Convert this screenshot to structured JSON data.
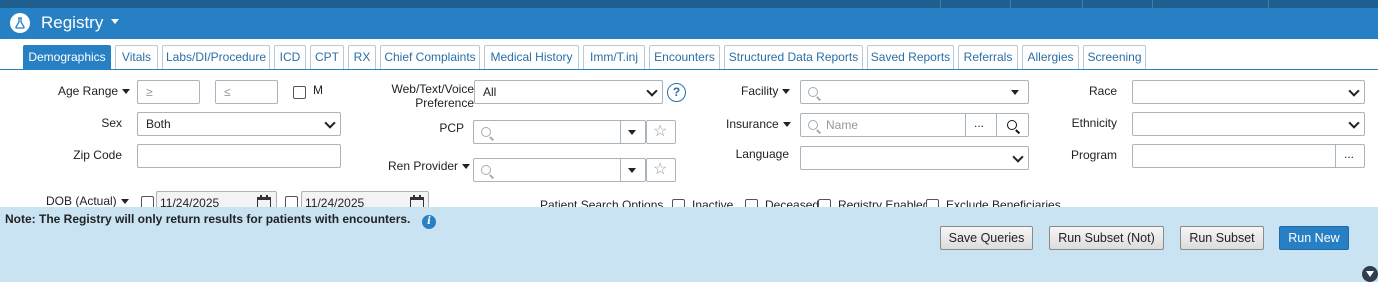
{
  "app": {
    "title": "Registry"
  },
  "tabs": [
    "Demographics",
    "Vitals",
    "Labs/DI/Procedure",
    "ICD",
    "CPT",
    "RX",
    "Chief Complaints",
    "Medical History",
    "Imm/T.inj",
    "Encounters",
    "Structured Data Reports",
    "Saved Reports",
    "Referrals",
    "Allergies",
    "Screening"
  ],
  "active_tab": "Demographics",
  "form": {
    "age_range": {
      "label": "Age Range",
      "min_placeholder": "≥",
      "max_placeholder": "≤",
      "m_label": "M"
    },
    "sex": {
      "label": "Sex",
      "value": "Both"
    },
    "zip": {
      "label": "Zip Code",
      "value": ""
    },
    "dob": {
      "label": "DOB (Actual)",
      "from": "11/24/2025",
      "to": "11/24/2025"
    },
    "preference": {
      "label": "Web/Text/Voice Preference",
      "value": "All"
    },
    "pcp": {
      "label": "PCP",
      "value": ""
    },
    "ren_provider": {
      "label": "Ren Provider",
      "value": ""
    },
    "facility": {
      "label": "Facility",
      "value": ""
    },
    "insurance": {
      "label": "Insurance",
      "placeholder": "Name",
      "ellipsis": "..."
    },
    "language": {
      "label": "Language",
      "value": ""
    },
    "race": {
      "label": "Race",
      "value": ""
    },
    "ethnicity": {
      "label": "Ethnicity",
      "value": ""
    },
    "program": {
      "label": "Program",
      "value": "",
      "ellipsis": "..."
    },
    "search_options": {
      "label": "Patient Search Options",
      "inactive": "Inactive",
      "deceased": "Deceased",
      "registry_enabled": "Registry Enabled",
      "exclude_beneficiaries": "Exclude Beneficiaries"
    }
  },
  "footer": {
    "note": "Note: The Registry will only return results for patients with encounters.",
    "buttons": {
      "save_queries": "Save Queries",
      "run_subset_not": "Run Subset (Not)",
      "run_subset": "Run Subset",
      "run_new": "Run New"
    }
  },
  "colors": {
    "primary": "#2880c4",
    "footer_bg": "#c9e3f3",
    "topbar": "#1f5f8f"
  }
}
